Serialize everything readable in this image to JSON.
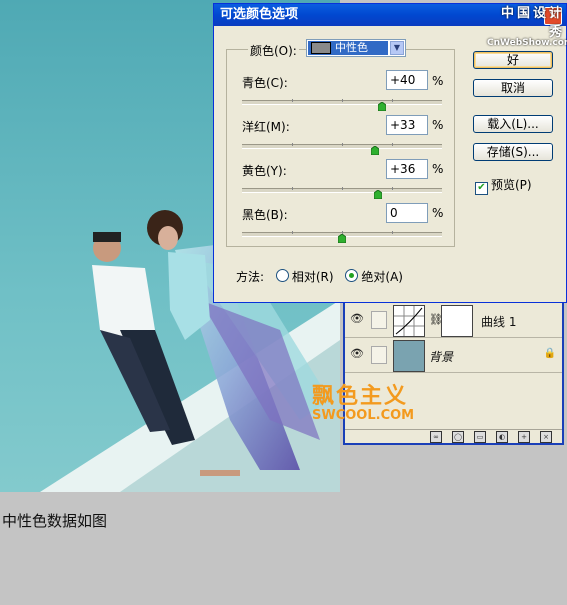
{
  "dialog": {
    "title": "可选颜色选项",
    "colors_label": "颜色(O):",
    "colors_value": "中性色",
    "sliders": [
      {
        "label": "青色(C):",
        "value": "+40",
        "level": 0.7
      },
      {
        "label": "洋红(M):",
        "value": "+33",
        "level": 0.665
      },
      {
        "label": "黄色(Y):",
        "value": "+36",
        "level": 0.68
      },
      {
        "label": "黑色(B):",
        "value": "0",
        "level": 0.5
      }
    ],
    "percent": "%",
    "buttons": {
      "ok": "好",
      "cancel": "取消",
      "load": "载入(L)...",
      "save": "存储(S)..."
    },
    "preview_label": "预览(P)",
    "preview_checked": true,
    "method_label": "方法:",
    "method_relative": "相对(R)",
    "method_absolute": "绝对(A)",
    "method_selected": "absolute"
  },
  "layers": {
    "items": [
      {
        "name": "曲线 1",
        "kind": "adjustment"
      },
      {
        "name": "背景",
        "kind": "background",
        "locked": true
      }
    ]
  },
  "watermark": {
    "site_cn": "中国设计秀",
    "site_en": "CnWebShow.com",
    "brand_cn": "飘色主义",
    "brand_en": "SWCOOL.COM"
  },
  "caption": "中性色数据如图",
  "colors": {
    "accent": "#0a5ee0",
    "check": "#21a121",
    "watermark": "#f39a1e"
  }
}
